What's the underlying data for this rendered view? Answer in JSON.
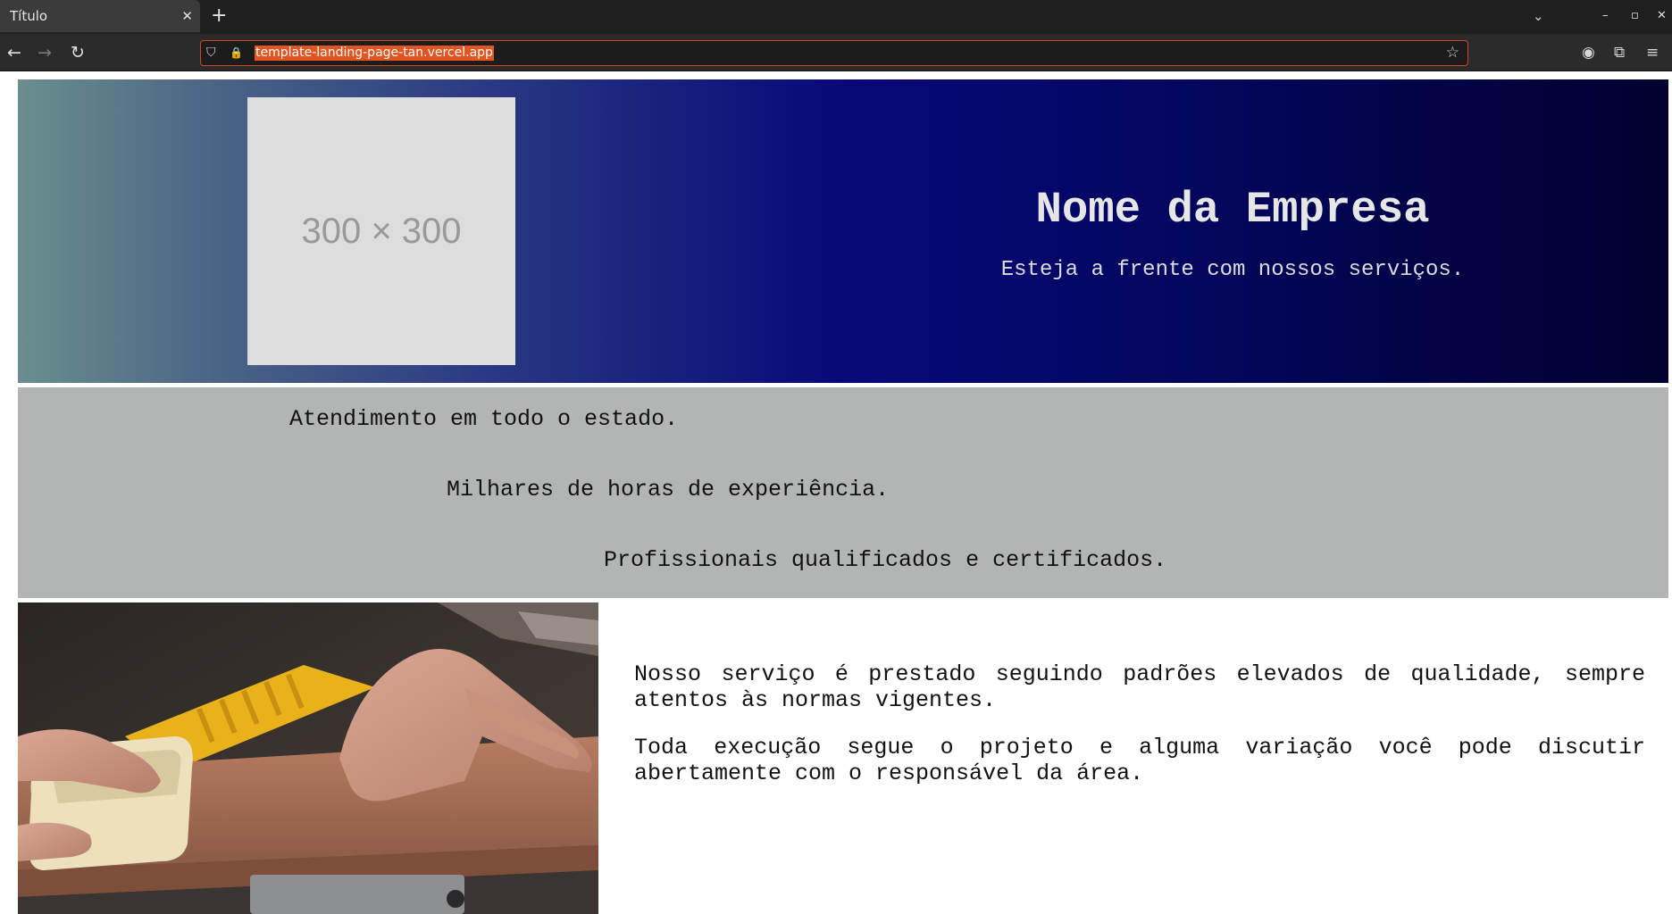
{
  "browser": {
    "tab_title": "Título",
    "tab_close": "✕",
    "new_tab": "+",
    "tab_list": "⌄",
    "win_minimize": "–",
    "win_maximize": "▫",
    "win_close": "✕",
    "url": "template-landing-page-tan.vercel.app",
    "icons": {
      "back": "←",
      "forward": "→",
      "reload": "↻",
      "shield": "⛉",
      "lock": "🔒",
      "star": "☆",
      "account": "◉",
      "extensions": "⧉",
      "menu": "≡"
    }
  },
  "hero": {
    "placeholder_text": "300 × 300",
    "company_name": "Nome da Empresa",
    "tagline": "Esteja a frente com nossos serviços."
  },
  "features": [
    "Atendimento em todo o estado.",
    "Milhares de horas de experiência.",
    "Profissionais qualificados e certificados."
  ],
  "content": {
    "paragraphs": [
      "Nosso serviço é prestado seguindo padrões elevados de qualidade, sempre atentos às normas vigentes.",
      "Toda execução segue o projeto e alguma variação você pode discutir abertamente com o responsável da área."
    ],
    "image_subject": "hands-sanding-wood-photo"
  },
  "colors": {
    "hero_gradient_start": "#6a8e8e",
    "hero_gradient_end": "#010130",
    "features_bg": "#b3b5b4",
    "url_highlight": "#e25420"
  }
}
